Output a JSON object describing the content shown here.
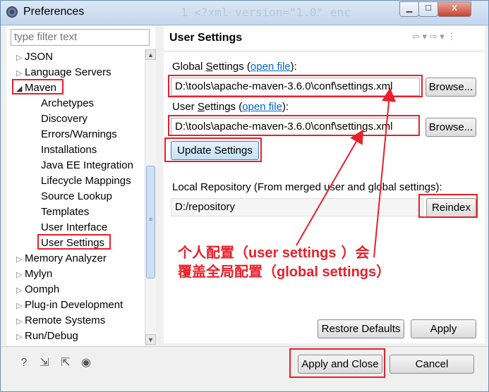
{
  "window": {
    "title": "Preferences",
    "background_code": "1 <?xml version=\"1.0\" enc",
    "controls": {
      "minimize": "▁",
      "maximize": "☐",
      "close": "X"
    }
  },
  "sidebar": {
    "filter_placeholder": "type filter text",
    "items": [
      {
        "label": "JSON",
        "arrow": "▷"
      },
      {
        "label": "Language Servers",
        "arrow": "▷"
      },
      {
        "label": "Maven",
        "arrow": "◢"
      },
      {
        "label": "Archetypes"
      },
      {
        "label": "Discovery"
      },
      {
        "label": "Errors/Warnings"
      },
      {
        "label": "Installations"
      },
      {
        "label": "Java EE Integration"
      },
      {
        "label": "Lifecycle Mappings"
      },
      {
        "label": "Source Lookup"
      },
      {
        "label": "Templates"
      },
      {
        "label": "User Interface"
      },
      {
        "label": "User Settings"
      },
      {
        "label": "Memory Analyzer",
        "arrow": "▷"
      },
      {
        "label": "Mylyn",
        "arrow": "▷"
      },
      {
        "label": "Oomph",
        "arrow": "▷"
      },
      {
        "label": "Plug-in Development",
        "arrow": "▷"
      },
      {
        "label": "Remote Systems",
        "arrow": "▷"
      },
      {
        "label": "Run/Debug",
        "arrow": "▷"
      }
    ]
  },
  "main": {
    "title": "User Settings",
    "global": {
      "label_prefix": "Global ",
      "label_mnemonic": "S",
      "label_rest": "ettings (",
      "link": "open file",
      "label_suffix": "):",
      "value": "D:\\tools\\apache-maven-3.6.0\\conf\\settings.xml",
      "browse": "Browse..."
    },
    "user": {
      "label_prefix": "User ",
      "label_mnemonic": "S",
      "label_rest": "ettings (",
      "link": "open file",
      "label_suffix": "):",
      "value": "D:\\tools\\apache-maven-3.6.0\\conf\\settings.xml",
      "browse": "Browse..."
    },
    "update_button": "Update Settings",
    "local_repo_label": "Local Repository (From merged user and global settings):",
    "local_repo_value": "D:/repository",
    "reindex_button": "Reindex",
    "restore_defaults": "Restore Defaults",
    "apply": "Apply"
  },
  "annotation": {
    "line1_a": "个人配置（",
    "line1_b": "user settings",
    "line1_c": " ）会",
    "line2_a": "覆盖全局配置（",
    "line2_b": "global settings",
    "line2_c": "）"
  },
  "footer": {
    "apply_and_close": "Apply and Close",
    "cancel": "Cancel"
  },
  "colors": {
    "annotation_red": "#e8202a",
    "link_blue": "#0066cc"
  }
}
